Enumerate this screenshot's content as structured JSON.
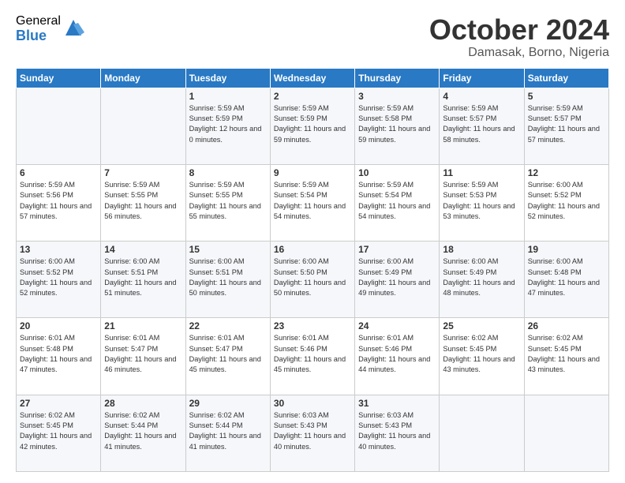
{
  "header": {
    "logo_general": "General",
    "logo_blue": "Blue",
    "month_title": "October 2024",
    "location": "Damasak, Borno, Nigeria"
  },
  "days_of_week": [
    "Sunday",
    "Monday",
    "Tuesday",
    "Wednesday",
    "Thursday",
    "Friday",
    "Saturday"
  ],
  "weeks": [
    [
      {
        "day": "",
        "info": ""
      },
      {
        "day": "",
        "info": ""
      },
      {
        "day": "1",
        "info": "Sunrise: 5:59 AM\nSunset: 5:59 PM\nDaylight: 12 hours and 0 minutes."
      },
      {
        "day": "2",
        "info": "Sunrise: 5:59 AM\nSunset: 5:59 PM\nDaylight: 11 hours and 59 minutes."
      },
      {
        "day": "3",
        "info": "Sunrise: 5:59 AM\nSunset: 5:58 PM\nDaylight: 11 hours and 59 minutes."
      },
      {
        "day": "4",
        "info": "Sunrise: 5:59 AM\nSunset: 5:57 PM\nDaylight: 11 hours and 58 minutes."
      },
      {
        "day": "5",
        "info": "Sunrise: 5:59 AM\nSunset: 5:57 PM\nDaylight: 11 hours and 57 minutes."
      }
    ],
    [
      {
        "day": "6",
        "info": "Sunrise: 5:59 AM\nSunset: 5:56 PM\nDaylight: 11 hours and 57 minutes."
      },
      {
        "day": "7",
        "info": "Sunrise: 5:59 AM\nSunset: 5:55 PM\nDaylight: 11 hours and 56 minutes."
      },
      {
        "day": "8",
        "info": "Sunrise: 5:59 AM\nSunset: 5:55 PM\nDaylight: 11 hours and 55 minutes."
      },
      {
        "day": "9",
        "info": "Sunrise: 5:59 AM\nSunset: 5:54 PM\nDaylight: 11 hours and 54 minutes."
      },
      {
        "day": "10",
        "info": "Sunrise: 5:59 AM\nSunset: 5:54 PM\nDaylight: 11 hours and 54 minutes."
      },
      {
        "day": "11",
        "info": "Sunrise: 5:59 AM\nSunset: 5:53 PM\nDaylight: 11 hours and 53 minutes."
      },
      {
        "day": "12",
        "info": "Sunrise: 6:00 AM\nSunset: 5:52 PM\nDaylight: 11 hours and 52 minutes."
      }
    ],
    [
      {
        "day": "13",
        "info": "Sunrise: 6:00 AM\nSunset: 5:52 PM\nDaylight: 11 hours and 52 minutes."
      },
      {
        "day": "14",
        "info": "Sunrise: 6:00 AM\nSunset: 5:51 PM\nDaylight: 11 hours and 51 minutes."
      },
      {
        "day": "15",
        "info": "Sunrise: 6:00 AM\nSunset: 5:51 PM\nDaylight: 11 hours and 50 minutes."
      },
      {
        "day": "16",
        "info": "Sunrise: 6:00 AM\nSunset: 5:50 PM\nDaylight: 11 hours and 50 minutes."
      },
      {
        "day": "17",
        "info": "Sunrise: 6:00 AM\nSunset: 5:49 PM\nDaylight: 11 hours and 49 minutes."
      },
      {
        "day": "18",
        "info": "Sunrise: 6:00 AM\nSunset: 5:49 PM\nDaylight: 11 hours and 48 minutes."
      },
      {
        "day": "19",
        "info": "Sunrise: 6:00 AM\nSunset: 5:48 PM\nDaylight: 11 hours and 47 minutes."
      }
    ],
    [
      {
        "day": "20",
        "info": "Sunrise: 6:01 AM\nSunset: 5:48 PM\nDaylight: 11 hours and 47 minutes."
      },
      {
        "day": "21",
        "info": "Sunrise: 6:01 AM\nSunset: 5:47 PM\nDaylight: 11 hours and 46 minutes."
      },
      {
        "day": "22",
        "info": "Sunrise: 6:01 AM\nSunset: 5:47 PM\nDaylight: 11 hours and 45 minutes."
      },
      {
        "day": "23",
        "info": "Sunrise: 6:01 AM\nSunset: 5:46 PM\nDaylight: 11 hours and 45 minutes."
      },
      {
        "day": "24",
        "info": "Sunrise: 6:01 AM\nSunset: 5:46 PM\nDaylight: 11 hours and 44 minutes."
      },
      {
        "day": "25",
        "info": "Sunrise: 6:02 AM\nSunset: 5:45 PM\nDaylight: 11 hours and 43 minutes."
      },
      {
        "day": "26",
        "info": "Sunrise: 6:02 AM\nSunset: 5:45 PM\nDaylight: 11 hours and 43 minutes."
      }
    ],
    [
      {
        "day": "27",
        "info": "Sunrise: 6:02 AM\nSunset: 5:45 PM\nDaylight: 11 hours and 42 minutes."
      },
      {
        "day": "28",
        "info": "Sunrise: 6:02 AM\nSunset: 5:44 PM\nDaylight: 11 hours and 41 minutes."
      },
      {
        "day": "29",
        "info": "Sunrise: 6:02 AM\nSunset: 5:44 PM\nDaylight: 11 hours and 41 minutes."
      },
      {
        "day": "30",
        "info": "Sunrise: 6:03 AM\nSunset: 5:43 PM\nDaylight: 11 hours and 40 minutes."
      },
      {
        "day": "31",
        "info": "Sunrise: 6:03 AM\nSunset: 5:43 PM\nDaylight: 11 hours and 40 minutes."
      },
      {
        "day": "",
        "info": ""
      },
      {
        "day": "",
        "info": ""
      }
    ]
  ]
}
